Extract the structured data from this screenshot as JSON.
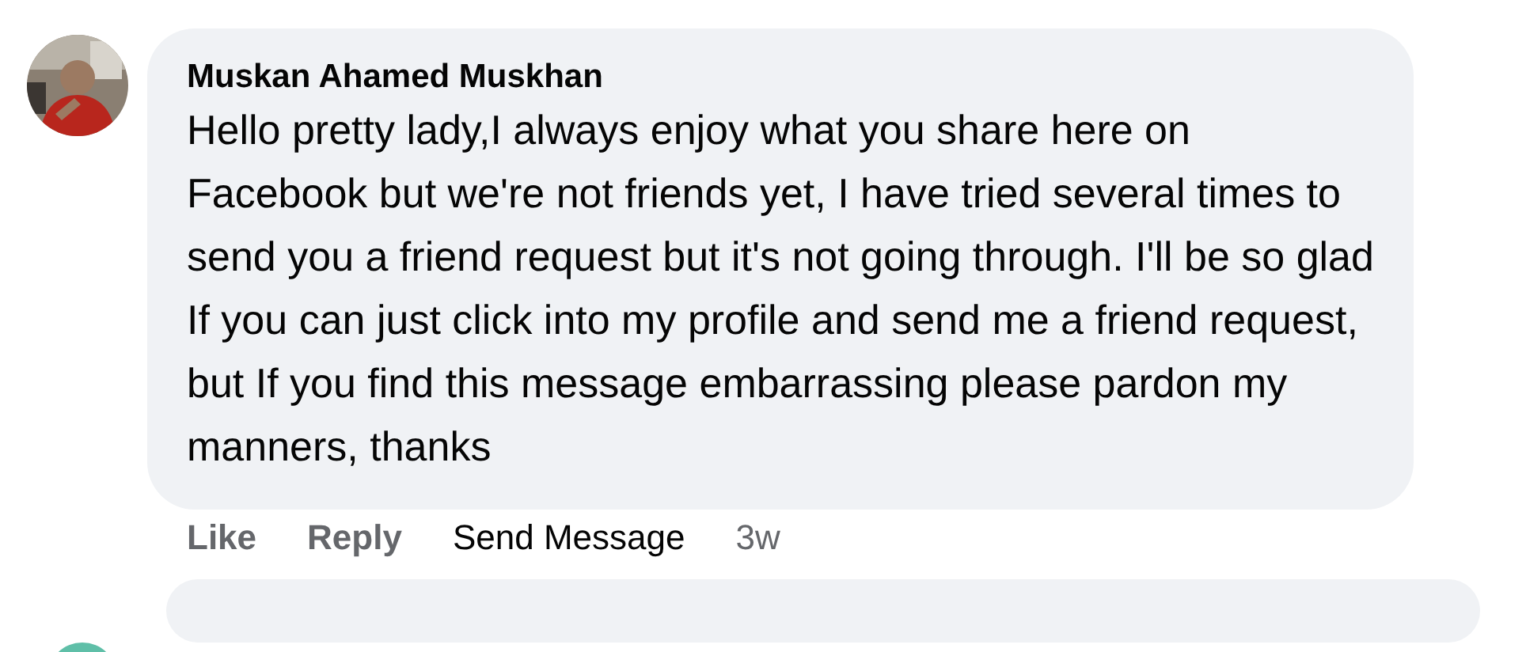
{
  "comment": {
    "author": "Muskan Ahamed Muskhan",
    "text": "Hello pretty lady,I always enjoy what you share here on Facebook but we're not friends yet, I have tried several times to send you a friend request but it's not going through. I'll be so glad If you can just click into my profile and send me a friend request, but If you find this message embarrassing please pardon my manners, thanks",
    "actions": [
      {
        "kind": "action",
        "label": "Like"
      },
      {
        "kind": "action",
        "label": "Reply"
      },
      {
        "kind": "message",
        "label": "Send Message"
      },
      {
        "kind": "time",
        "label": "3w"
      }
    ]
  }
}
